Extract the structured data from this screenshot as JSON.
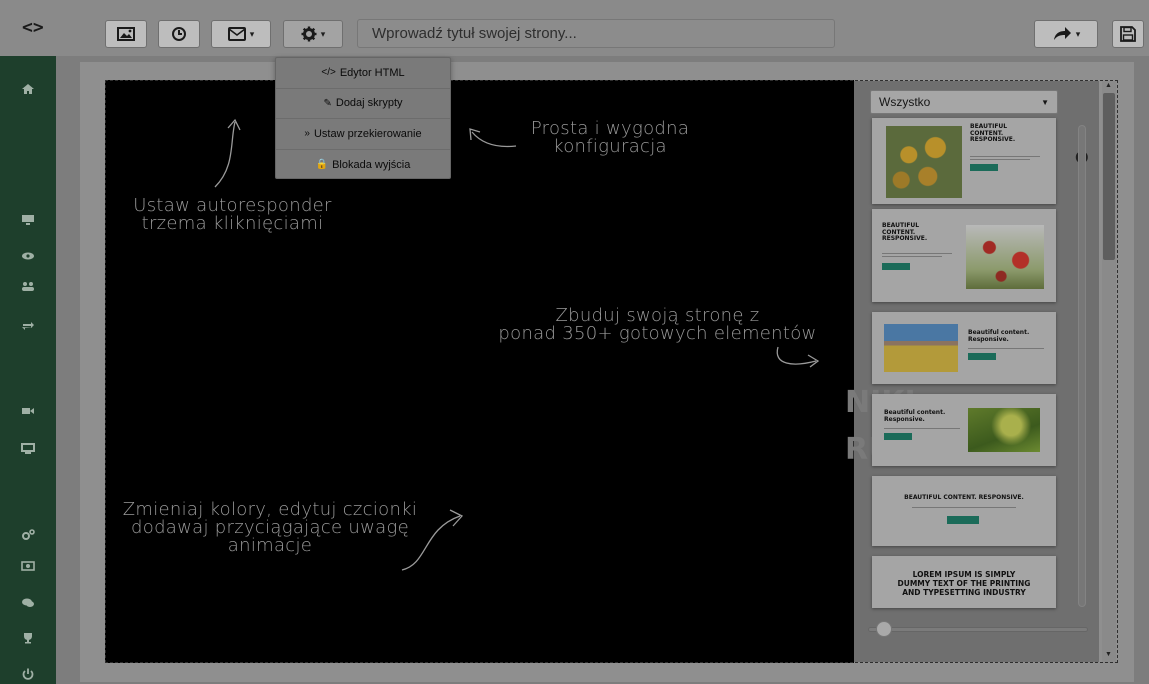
{
  "topbar": {
    "code_toggle": "<>",
    "title_placeholder": "Wprowadź tytuł swojej strony...",
    "buttons": [
      {
        "name": "image",
        "icon": "image-icon"
      },
      {
        "name": "clock",
        "icon": "clock-icon"
      },
      {
        "name": "mail",
        "icon": "envelope-icon",
        "caret": "▾"
      },
      {
        "name": "settings",
        "icon": "gear-icon",
        "caret": "▾"
      },
      {
        "name": "redo",
        "icon": "share-arrow-icon",
        "caret": "▾"
      },
      {
        "name": "save",
        "icon": "floppy-disk-icon"
      }
    ]
  },
  "settings_menu": {
    "items": [
      {
        "icon": "</>",
        "label": "Edytor HTML"
      },
      {
        "icon": "✎",
        "label": "Dodaj skrypty"
      },
      {
        "icon": "»",
        "label": "Ustaw przekierowanie"
      },
      {
        "icon": "🔒",
        "label": "Blokada wyjścia"
      }
    ]
  },
  "sidebar": {
    "items": [
      {
        "icon": "home-icon",
        "glyph": "⌂"
      },
      {
        "icon": "desktop-icon",
        "glyph": "▭"
      },
      {
        "icon": "eye-icon",
        "glyph": "◉"
      },
      {
        "icon": "users-icon",
        "glyph": "☗"
      },
      {
        "icon": "retweet-icon",
        "glyph": "⇄"
      },
      {
        "icon": "video-camera-icon",
        "glyph": "▶"
      },
      {
        "icon": "monitor-icon",
        "glyph": "▣"
      },
      {
        "icon": "cogs-icon",
        "glyph": "⚙"
      },
      {
        "icon": "money-icon",
        "glyph": "▤"
      },
      {
        "icon": "comments-icon",
        "glyph": "✦"
      },
      {
        "icon": "trophy-icon",
        "glyph": "♆"
      },
      {
        "icon": "power-icon",
        "glyph": "⏻"
      }
    ]
  },
  "annotations": {
    "autoresponder": "Ustaw autoresponder\ntrzema kliknięciami",
    "config": "Prosta i wygodna\nkonfiguracja",
    "build": "Zbuduj swoją stronę z\nponad 350+ gotowych elementów",
    "colors": "Zmieniaj kolory, edytuj czcionki\ndodawaj przyciągające uwagę\nanimacje"
  },
  "panel": {
    "filter_value": "Wszystko",
    "thumbs": [
      {
        "title": "BEAUTIFUL\nCONTENT.\nRESPONSIVE.",
        "image": "sunflowers"
      },
      {
        "title": "BEAUTIFUL\nCONTENT.\nRESPONSIVE.",
        "image": "poppies"
      },
      {
        "title": "Beautiful content.\nResponsive.",
        "image": "desert"
      },
      {
        "title": "Beautiful content.\nResponsive.",
        "image": "grass"
      },
      {
        "title": "BEAUTIFUL CONTENT. RESPONSIVE.",
        "image": ""
      },
      {
        "title": "LOREM IPSUM IS SIMPLY\nDUMMY TEXT OF THE PRINTING\nAND TYPESETTING INDUSTRY",
        "image": ""
      }
    ]
  },
  "colors": {
    "sidebar": "#1e3f2c",
    "accent_button": "#1b6b59",
    "canvas": "#000000"
  }
}
